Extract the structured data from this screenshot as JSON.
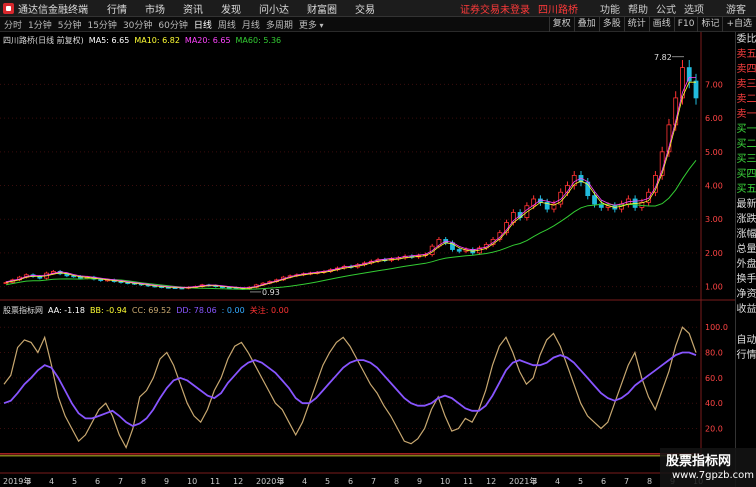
{
  "menubar": {
    "app_name": "通达信金融终端",
    "menus": [
      "行情",
      "市场",
      "资讯",
      "发现",
      "问小达",
      "财富圈",
      "交易"
    ],
    "notice": "证券交易未登录",
    "stock_name": "四川路桥",
    "right_menus": [
      "功能",
      "帮助",
      "公式",
      "选项"
    ],
    "guest": "游客"
  },
  "periodbar": {
    "tabs": [
      "分时",
      "1分钟",
      "5分钟",
      "15分钟",
      "30分钟",
      "60分钟",
      "日线",
      "周线",
      "月线",
      "多周期",
      "更多"
    ],
    "active": "日线",
    "tools": [
      "复权",
      "叠加",
      "多股",
      "统计",
      "画线",
      "F10",
      "标记",
      "+自选"
    ]
  },
  "main_legend": {
    "title": "四川路桥(日线 前复权)",
    "items": [
      {
        "label": "MA5: 6.65",
        "color": "#ffffff"
      },
      {
        "label": "MA10: 6.82",
        "color": "#ffff33"
      },
      {
        "label": "MA20: 6.65",
        "color": "#ff44ff"
      },
      {
        "label": "MA60: 5.36",
        "color": "#33cc33"
      }
    ]
  },
  "sub_legend": {
    "title": "股票指标网",
    "items": [
      {
        "label": "AA: -1.18",
        "color": "#ffffff"
      },
      {
        "label": "BB: -0.94",
        "color": "#ffff33"
      },
      {
        "label": "CC: 69.52",
        "color": "#c8a870"
      },
      {
        "label": "DD: 78.06",
        "color": "#8855ff"
      },
      {
        "label": ": 0.00",
        "color": "#33aaff"
      },
      {
        "label": "关注: 0.00",
        "color": "#ff3333"
      }
    ]
  },
  "colors": {
    "price_axis": "#ff4444",
    "up": "#ff3333",
    "down": "#22bbdd",
    "ma60": "#33cc33",
    "cc": "#c8a870",
    "dd": "#8855ff"
  },
  "chart_data": {
    "type": "candlestick",
    "main_axis": {
      "ticks": [
        1.0,
        2.0,
        3.0,
        4.0,
        5.0,
        6.0,
        7.0
      ],
      "labels": [
        "1.00",
        "2.00",
        "3.00",
        "4.00",
        "5.00",
        "6.00",
        "7.00"
      ],
      "ylim": [
        0.78,
        8.2
      ]
    },
    "annotations": [
      {
        "text": "7.82",
        "value": 7.82
      },
      {
        "text": "0.93",
        "value": 0.93
      }
    ],
    "close_series": [
      1.12,
      1.2,
      1.28,
      1.35,
      1.3,
      1.25,
      1.4,
      1.45,
      1.38,
      1.32,
      1.3,
      1.25,
      1.28,
      1.22,
      1.18,
      1.2,
      1.15,
      1.12,
      1.1,
      1.08,
      1.05,
      1.02,
      1.0,
      0.98,
      0.97,
      0.96,
      0.95,
      0.98,
      1.0,
      1.05,
      1.03,
      1.0,
      0.98,
      0.97,
      0.95,
      0.93,
      0.98,
      1.05,
      1.1,
      1.15,
      1.2,
      1.28,
      1.32,
      1.35,
      1.38,
      1.4,
      1.42,
      1.45,
      1.5,
      1.55,
      1.6,
      1.58,
      1.65,
      1.7,
      1.75,
      1.8,
      1.78,
      1.82,
      1.85,
      1.9,
      1.88,
      1.92,
      1.95,
      2.2,
      2.4,
      2.3,
      2.1,
      2.05,
      2.1,
      2.0,
      2.15,
      2.25,
      2.4,
      2.6,
      2.9,
      3.2,
      3.05,
      3.4,
      3.6,
      3.5,
      3.3,
      3.45,
      3.8,
      4.0,
      4.3,
      4.1,
      3.7,
      3.45,
      3.35,
      3.4,
      3.3,
      3.45,
      3.6,
      3.35,
      3.5,
      3.8,
      4.3,
      5.0,
      5.8,
      6.6,
      7.5,
      7.1,
      6.6
    ],
    "sub_axis": {
      "ticks": [
        20,
        40,
        60,
        80,
        100
      ],
      "labels": [
        "20.0",
        "40.0",
        "60.0",
        "80.0",
        "100.0"
      ],
      "ylim": [
        -8,
        112
      ]
    },
    "cc_series": [
      55,
      62,
      84,
      90,
      88,
      80,
      92,
      70,
      45,
      30,
      20,
      10,
      15,
      25,
      35,
      40,
      30,
      15,
      5,
      20,
      45,
      50,
      60,
      75,
      80,
      70,
      55,
      40,
      30,
      25,
      35,
      50,
      60,
      75,
      85,
      88,
      80,
      70,
      60,
      50,
      40,
      35,
      25,
      15,
      25,
      40,
      55,
      70,
      80,
      88,
      92,
      85,
      75,
      65,
      55,
      48,
      38,
      30,
      20,
      10,
      8,
      12,
      20,
      35,
      45,
      30,
      18,
      20,
      28,
      25,
      35,
      50,
      70,
      85,
      92,
      80,
      65,
      55,
      60,
      78,
      90,
      95,
      85,
      70,
      55,
      40,
      30,
      25,
      20,
      25,
      40,
      55,
      70,
      80,
      60,
      45,
      35,
      50,
      65,
      85,
      100,
      95,
      80
    ],
    "dd_series": [
      40,
      42,
      48,
      55,
      60,
      66,
      70,
      68,
      60,
      50,
      40,
      32,
      28,
      28,
      30,
      32,
      34,
      30,
      25,
      22,
      24,
      28,
      35,
      44,
      52,
      58,
      60,
      58,
      54,
      50,
      46,
      44,
      48,
      56,
      62,
      68,
      72,
      74,
      72,
      68,
      64,
      58,
      52,
      44,
      40,
      40,
      44,
      50,
      56,
      62,
      68,
      72,
      74,
      74,
      72,
      68,
      62,
      56,
      50,
      44,
      40,
      38,
      38,
      40,
      44,
      46,
      44,
      40,
      36,
      34,
      34,
      38,
      46,
      56,
      66,
      72,
      74,
      72,
      70,
      70,
      72,
      76,
      78,
      76,
      72,
      66,
      60,
      54,
      48,
      44,
      42,
      44,
      48,
      54,
      58,
      62,
      66,
      70,
      74,
      78,
      80,
      80,
      78
    ],
    "x_axis": {
      "labels": [
        "2019年",
        "3",
        "4",
        "5",
        "6",
        "7",
        "8",
        "9",
        "10",
        "11",
        "12",
        "2020年",
        "3",
        "4",
        "5",
        "6",
        "7",
        "8",
        "9",
        "10",
        "11",
        "12",
        "2021年",
        "3",
        "4",
        "5",
        "6",
        "7",
        "8",
        "9",
        "10"
      ]
    }
  }
}
